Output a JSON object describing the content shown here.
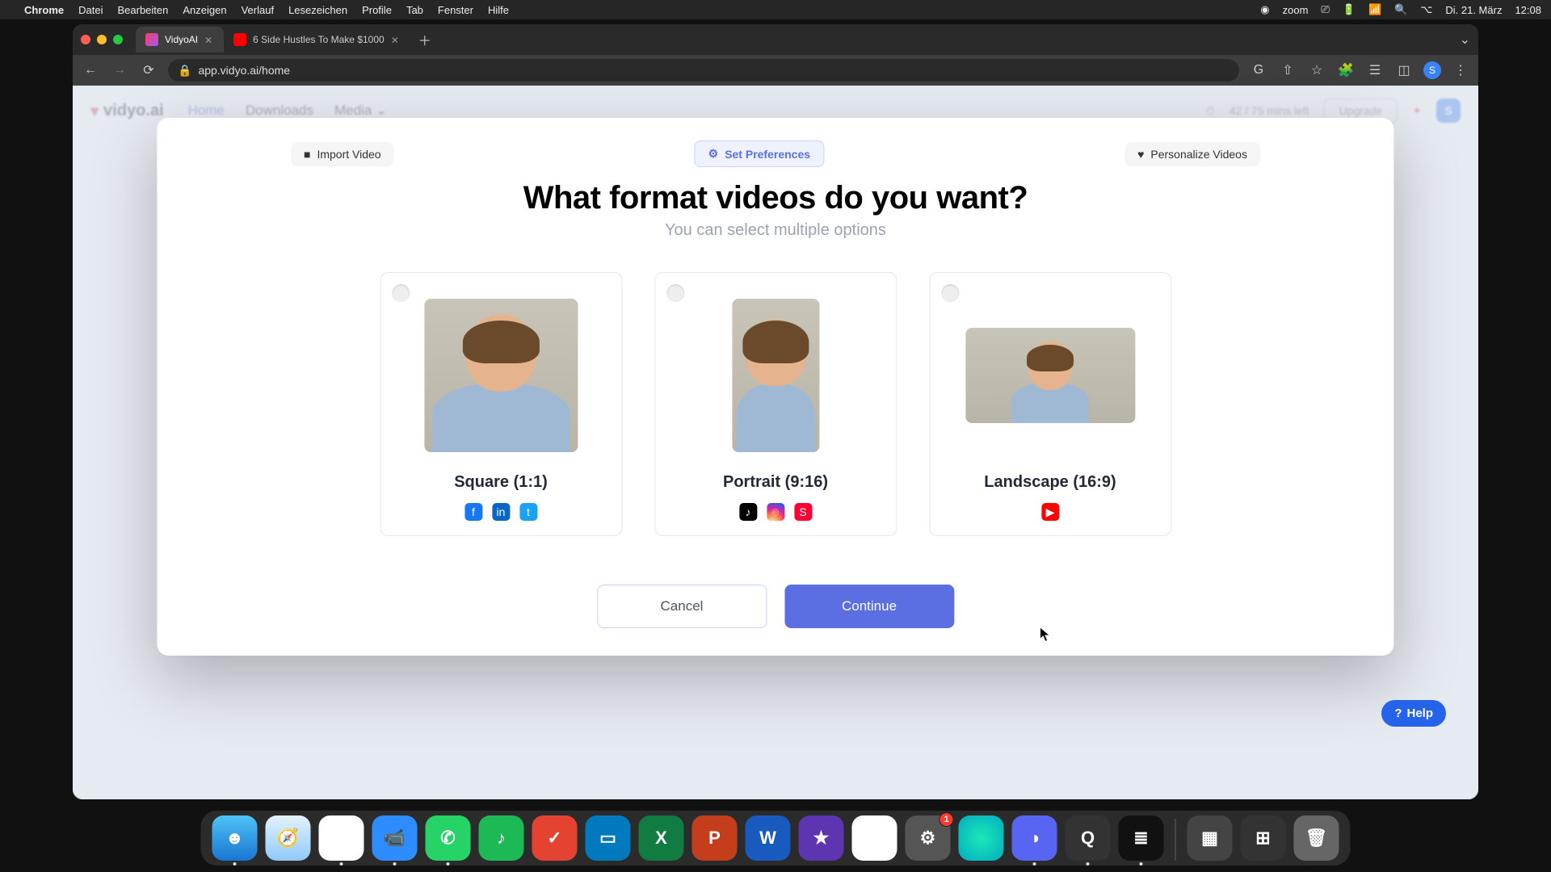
{
  "menubar": {
    "app": "Chrome",
    "items": [
      "Datei",
      "Bearbeiten",
      "Anzeigen",
      "Verlauf",
      "Lesezeichen",
      "Profile",
      "Tab",
      "Fenster",
      "Hilfe"
    ],
    "right": {
      "zoom": "zoom",
      "date": "Di. 21. März",
      "time": "12:08"
    }
  },
  "browser": {
    "tabs": [
      {
        "title": "VidyoAI",
        "active": true
      },
      {
        "title": "6 Side Hustles To Make $1000",
        "active": false
      }
    ],
    "url": "app.vidyo.ai/home",
    "avatar_initial": "S"
  },
  "header": {
    "brand": "vidyo.ai",
    "nav": [
      {
        "label": "Home",
        "active": true
      },
      {
        "label": "Downloads",
        "active": false
      },
      {
        "label": "Media",
        "active": false,
        "chevron": true
      }
    ],
    "minutes": "42 / 75 mins left",
    "upgrade": "Upgrade",
    "user_initial": "S"
  },
  "steps": [
    {
      "label": "Import Video",
      "icon": "camera",
      "active": false
    },
    {
      "label": "Set Preferences",
      "icon": "gear",
      "active": true
    },
    {
      "label": "Personalize Videos",
      "icon": "heart",
      "active": false
    }
  ],
  "modal": {
    "title": "What format videos do you want?",
    "subtitle": "You can select multiple options",
    "cancel": "Cancel",
    "continue": "Continue"
  },
  "cards": [
    {
      "title": "Square (1:1)",
      "shape": "square",
      "socials": [
        "facebook",
        "linkedin",
        "twitter"
      ]
    },
    {
      "title": "Portrait (9:16)",
      "shape": "portrait",
      "socials": [
        "tiktok",
        "instagram",
        "shorts"
      ]
    },
    {
      "title": "Landscape (16:9)",
      "shape": "landscape",
      "socials": [
        "youtube"
      ]
    }
  ],
  "help": "Help",
  "dock": {
    "items": [
      {
        "name": "finder",
        "color": "linear-gradient(180deg,#4fc3f7,#1976d2)",
        "glyph": "☻",
        "running": true
      },
      {
        "name": "safari",
        "color": "linear-gradient(180deg,#e3f2fd,#90caf9)",
        "glyph": "🧭"
      },
      {
        "name": "chrome",
        "color": "#fff",
        "glyph": "◉",
        "running": true
      },
      {
        "name": "zoom",
        "color": "#2d8cff",
        "glyph": "📹",
        "running": true
      },
      {
        "name": "whatsapp",
        "color": "#25d366",
        "glyph": "✆",
        "running": true
      },
      {
        "name": "spotify",
        "color": "#1db954",
        "glyph": "♪"
      },
      {
        "name": "todoist",
        "color": "#e44332",
        "glyph": "✓"
      },
      {
        "name": "trello",
        "color": "#0079bf",
        "glyph": "▭"
      },
      {
        "name": "excel",
        "color": "#107c41",
        "glyph": "X"
      },
      {
        "name": "powerpoint",
        "color": "#c43e1c",
        "glyph": "P"
      },
      {
        "name": "word",
        "color": "#185abd",
        "glyph": "W"
      },
      {
        "name": "imovie",
        "color": "#5e35b1",
        "glyph": "★"
      },
      {
        "name": "drive",
        "color": "#fff",
        "glyph": "▲"
      },
      {
        "name": "settings",
        "color": "#555",
        "glyph": "⚙",
        "badge": "1"
      },
      {
        "name": "siri",
        "color": "radial-gradient(circle,#1de9b6,#00acc1)",
        "glyph": ""
      },
      {
        "name": "discord",
        "color": "#5865f2",
        "glyph": "◑",
        "running": true
      },
      {
        "name": "quicktime",
        "color": "#333",
        "glyph": "Q",
        "running": true
      },
      {
        "name": "audio",
        "color": "#111",
        "glyph": "≣",
        "running": true
      }
    ],
    "right": [
      {
        "name": "calculator",
        "color": "#444",
        "glyph": "▦"
      },
      {
        "name": "mission",
        "color": "#333",
        "glyph": "⊞"
      },
      {
        "name": "trash",
        "color": "#666",
        "glyph": "🗑"
      }
    ]
  }
}
